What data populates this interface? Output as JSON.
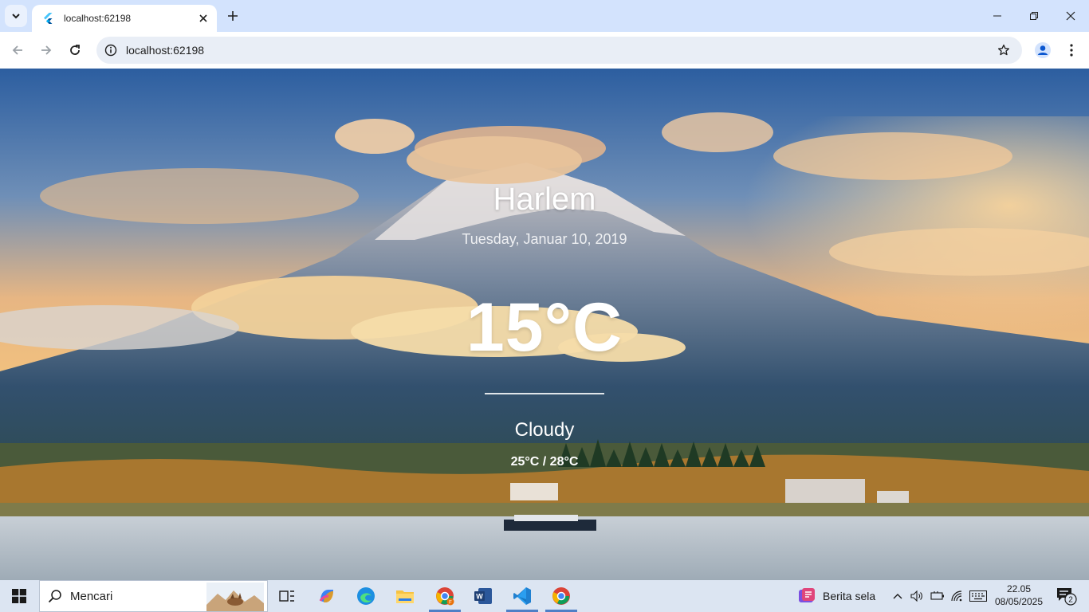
{
  "browser": {
    "tab_title": "localhost:62198",
    "url": "localhost:62198"
  },
  "weather": {
    "city": "Harlem",
    "date": "Tuesday, Januar 10, 2019",
    "temperature": "15°C",
    "condition": "Cloudy",
    "range": "25°C / 28°C"
  },
  "taskbar": {
    "search_placeholder": "Mencari",
    "news_label": "Berita sela",
    "time": "22.05",
    "date": "08/05/2025",
    "notification_count": "2",
    "apps": [
      "task-view",
      "copilot",
      "edge",
      "file-explorer",
      "chrome-profile",
      "word",
      "vscode",
      "chrome"
    ]
  },
  "colors": {
    "tab_strip": "#d3e3fd",
    "omnibox": "#e9eef6",
    "taskbar": "#dce5f2",
    "sky_top": "#2c5ea0",
    "sunset": "#f3c27e",
    "water": "#b9c4cc"
  }
}
